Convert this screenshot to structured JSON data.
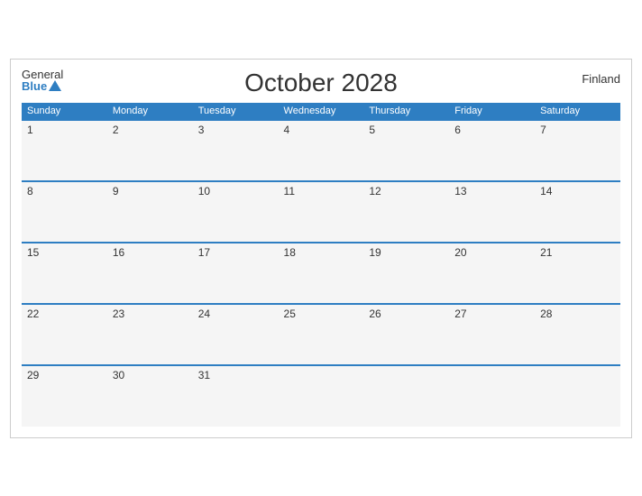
{
  "header": {
    "title": "October 2028",
    "country": "Finland",
    "logo_general": "General",
    "logo_blue": "Blue"
  },
  "weekdays": [
    "Sunday",
    "Monday",
    "Tuesday",
    "Wednesday",
    "Thursday",
    "Friday",
    "Saturday"
  ],
  "weeks": [
    [
      1,
      2,
      3,
      4,
      5,
      6,
      7
    ],
    [
      8,
      9,
      10,
      11,
      12,
      13,
      14
    ],
    [
      15,
      16,
      17,
      18,
      19,
      20,
      21
    ],
    [
      22,
      23,
      24,
      25,
      26,
      27,
      28
    ],
    [
      29,
      30,
      31,
      null,
      null,
      null,
      null
    ]
  ]
}
